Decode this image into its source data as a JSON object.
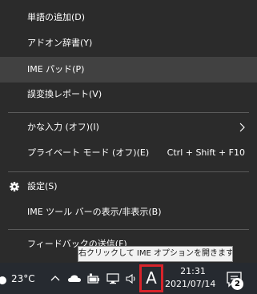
{
  "context_menu": {
    "items": [
      {
        "label": "単語の追加(D)"
      },
      {
        "label": "アドオン辞書(Y)"
      },
      {
        "label": "IME パッド(P)"
      },
      {
        "label": "誤変換レポート(V)"
      },
      {
        "label": "かな入力 (オフ)(I)"
      },
      {
        "label": "プライベート モード (オフ)(E)",
        "shortcut": "Ctrl + Shift + F10"
      },
      {
        "label": "設定(S)"
      },
      {
        "label": "IME ツール バーの表示/非表示(B)"
      },
      {
        "label": "フィードバックの送信(F)"
      }
    ]
  },
  "tooltip": {
    "text": "右クリックして IME オプションを開きます"
  },
  "taskbar": {
    "temperature": "23°C",
    "ime_indicator": "A",
    "time": "21:31",
    "date": "2021/07/14",
    "notification_count": "2"
  },
  "colors": {
    "menu_bg": "#2b2b2b",
    "menu_highlight": "#414141",
    "taskbar_bg": "#262a30",
    "ime_border": "#d8232a"
  }
}
